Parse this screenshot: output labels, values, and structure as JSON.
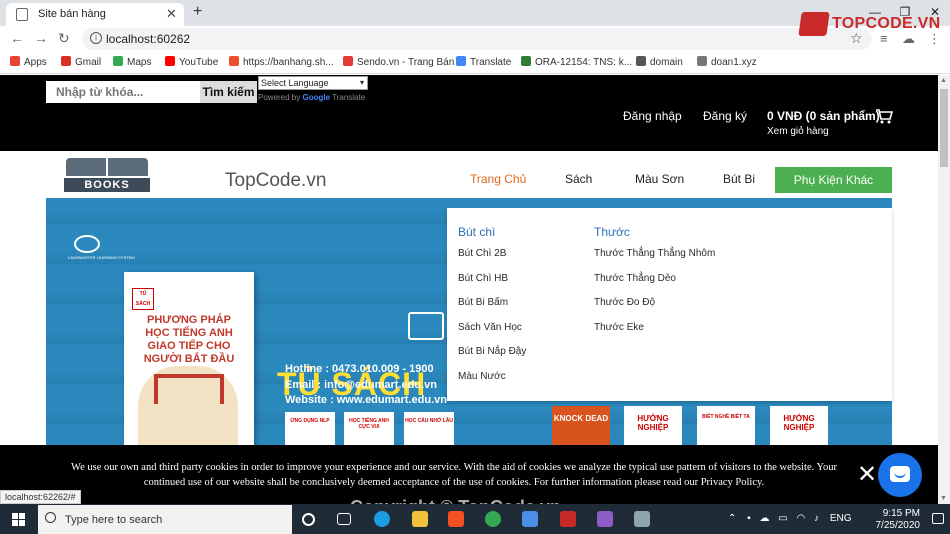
{
  "browser": {
    "tab_title": "Site bán hàng",
    "tab_close": "✕",
    "new_tab": "+",
    "url": "localhost:60262",
    "bookmarks": [
      {
        "label": "Apps",
        "color": "#e94235"
      },
      {
        "label": "Gmail",
        "color": "#d93025"
      },
      {
        "label": "Maps",
        "color": "#34a853"
      },
      {
        "label": "YouTube",
        "color": "#ff0000"
      },
      {
        "label": "https://banhang.sh...",
        "color": "#ee4d2d"
      },
      {
        "label": "Sendo.vn - Trang Bán",
        "color": "#e53935"
      },
      {
        "label": "Translate",
        "color": "#4285f4"
      },
      {
        "label": "ORA-12154: TNS: k...",
        "color": "#2e7d32"
      },
      {
        "label": "domain",
        "color": "#555555"
      },
      {
        "label": "doan1.xyz",
        "color": "#777777"
      }
    ],
    "status_link": "localhost:62262/#"
  },
  "watermark": {
    "logo_text": "TOPCODE.VN",
    "nav_text": "TopCode.vn",
    "bottom_text": "Copyright © TopCode.vn"
  },
  "topbar": {
    "search_placeholder": "Nhập từ khóa...",
    "search_button": "Tìm kiếm",
    "language_select": "Select Language",
    "powered_by": "Powered by",
    "google": "Google",
    "translate": "Translate",
    "login": "Đăng nhập",
    "register": "Đăng ký",
    "cart_total": "0 VNĐ (0 sản phẩm)",
    "cart_view": "Xem giỏ hàng"
  },
  "navbar": {
    "logo_label": "BOOKS",
    "items": [
      "Trang Chủ",
      "Sách",
      "Màu Sơn",
      "Bút Bi"
    ],
    "accessories": "Phụ Kiện Khác"
  },
  "megamenu": {
    "columns": [
      {
        "heading": "Bút chì",
        "items": [
          "Bút Chì 2B",
          "Bút Chì HB",
          "Bút Bi Bấm",
          "Sách Văn Học",
          "Bút Bi Nắp Đậy",
          "Màu Nước"
        ]
      },
      {
        "heading": "Thước",
        "items": [
          "Thước Thẳng Thẳng Nhôm",
          "Thước Thẳng Dẻo",
          "Thước Đo Độ",
          "Thước Eke"
        ]
      }
    ]
  },
  "banner": {
    "publisher_caption": "LANGMASTER LEARNING SYSTEM",
    "book_badge": "TỦ SÁCH",
    "book_title": "PHƯƠNG PHÁP HỌC TIẾNG ANH GIAO TIẾP CHO NGƯỜI BẮT ĐẦU",
    "headline": "TỦ SÁCH",
    "hotline": "Hotline  : 0473.010.009 - 1900",
    "email": "Email     : info@edumart.edu.vn",
    "website": "Website : www.edumart.edu.vn",
    "mini_books": [
      "ỨNG DỤNG NLP",
      "HỌC TIẾNG ANH CỰC VUI",
      "HỌC CÂU NHỚ LÂU"
    ],
    "right_books": [
      "KNOCK DEAD",
      "HƯỚNG NGHIỆP",
      "BIẾT NGHỀ BIẾT TA",
      "HƯỚNG NGHIỆP"
    ]
  },
  "cookie": {
    "text": "We use our own and third party cookies in order to improve your experience and our service. With the aid of cookies we analyze the typical use pattern of visitors to the website. Your continued use of our website shall be conclusively deemed acceptance of the use of cookies. For further information please read our Privacy Policy.",
    "close": "✕"
  },
  "taskbar": {
    "search_text": "Type here to search",
    "language": "ENG",
    "time": "9:15 PM",
    "date": "7/25/2020"
  }
}
